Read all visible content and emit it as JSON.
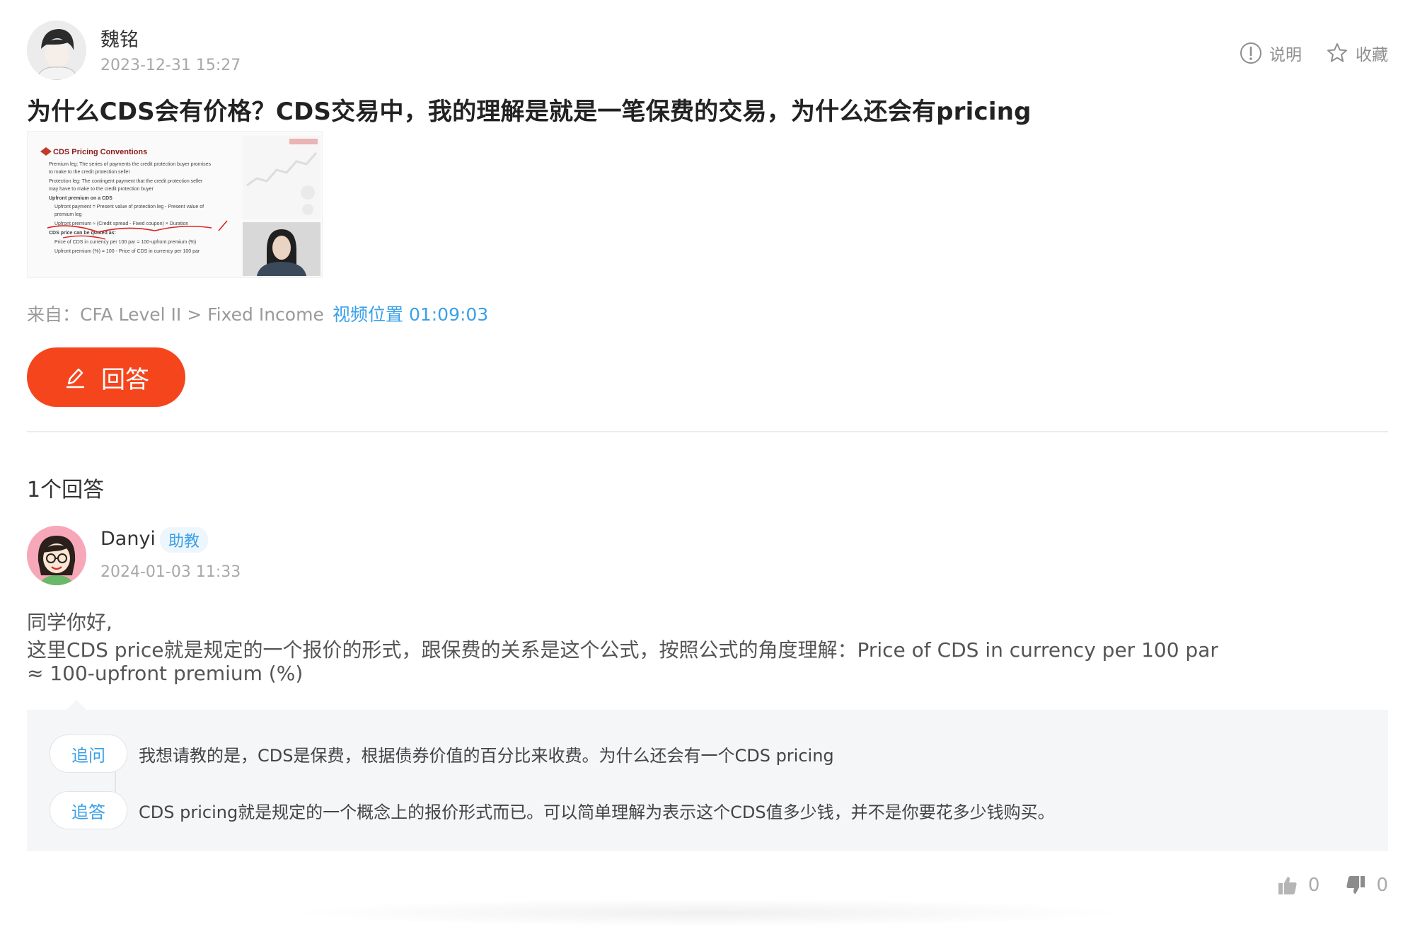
{
  "question": {
    "author": "魏铭",
    "datetime": "2023-12-31 15:27",
    "title": "为什么CDS会有价格？CDS交易中，我的理解是就是一笔保费的交易，为什么还会有pricing",
    "source": "来自：CFA Level II > Fixed Income",
    "video_position": "视频位置 01:09:03",
    "actions": {
      "explain": "说明",
      "favorite": "收藏"
    },
    "answer_button": "回答",
    "thumbnail": {
      "slide_title": "CDS Pricing Conventions",
      "lines": [
        "Premium leg: The series of payments the credit protection buyer promises",
        "to make to the credit protection seller",
        "Protection leg: The contingent payment that the credit protection seller",
        "may have to make to the credit protection buyer",
        "Upfront premium on a CDS",
        "Upfront payment = Present value of protection leg - Present value of",
        "premium leg",
        "Upfront premium ≈ (Credit spread - Fixed coupon) × Duration",
        "CDS price can be quoted as:",
        "Price of CDS in currency per 100 par = 100-upfront premium (%)",
        "Upfront premium (%) = 100 - Price of CDS in currency per 100 par"
      ]
    }
  },
  "answers_count": "1个回答",
  "answer": {
    "author": "Danyi",
    "badge": "助教",
    "datetime": "2024-01-03 11:33",
    "lines": [
      "同学你好,",
      "这里CDS price就是规定的一个报价的形式，跟保费的关系是这个公式，按照公式的角度理解：Price of CDS in currency per 100 par",
      "≈ 100-upfront premium (%)"
    ],
    "followups": [
      {
        "tag": "追问",
        "text": "我想请教的是，CDS是保费，根据债券价值的百分比来收费。为什么还会有一个CDS pricing"
      },
      {
        "tag": "追答",
        "text": "CDS pricing就是规定的一个概念上的报价形式而已。可以简单理解为表示这个CDS值多少钱，并不是你要花多少钱购买。"
      }
    ],
    "likes": "0",
    "dislikes": "0"
  },
  "colors": {
    "accent": "#f5451d",
    "link": "#3aa0e8"
  }
}
